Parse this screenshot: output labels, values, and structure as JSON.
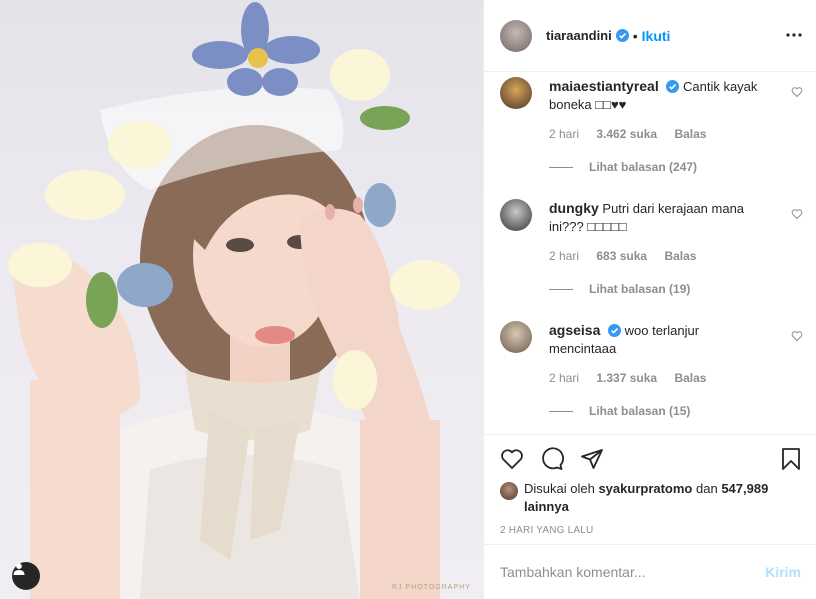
{
  "post": {
    "username": "tiaraandini",
    "follow_label": "Ikuti",
    "dot": "•",
    "watermark": "RJ PHOTOGRAPHY"
  },
  "comments": [
    {
      "username": "maiaestiantyreal",
      "text": "Cantik kayak boneka □□♥♥",
      "time": "2 hari",
      "likes": "3.462 suka",
      "reply_label": "Balas",
      "view_replies": "Lihat balasan (247)",
      "verified": true
    },
    {
      "username": "dungky",
      "text": "Putri dari kerajaan mana ini??? □□□□□",
      "time": "2 hari",
      "likes": "683 suka",
      "reply_label": "Balas",
      "view_replies": "Lihat balasan (19)",
      "verified": false
    },
    {
      "username": "agseisa",
      "text": "woo terlanjur mencintaaa",
      "time": "2 hari",
      "likes": "1.337 suka",
      "reply_label": "Balas",
      "view_replies": "Lihat balasan (15)",
      "verified": true
    }
  ],
  "liked_by": {
    "prefix": "Disukai oleh",
    "user": "syakurpratomo",
    "conj": "dan",
    "others": "547,989 lainnya"
  },
  "timeago": "2 HARI YANG LALU",
  "add_comment": {
    "placeholder": "Tambahkan komentar...",
    "post_label": "Kirim"
  },
  "icons": {
    "verified": "verified-badge-icon",
    "more": "more-options-icon",
    "heart": "heart-icon",
    "comment": "comment-icon",
    "share": "share-icon",
    "save": "bookmark-icon",
    "user_tag": "user-tag-icon"
  },
  "colors": {
    "accent": "#0095f6",
    "post_disabled": "#b2dffc",
    "secondary_text": "#8e8e8e",
    "border": "#efefef"
  }
}
